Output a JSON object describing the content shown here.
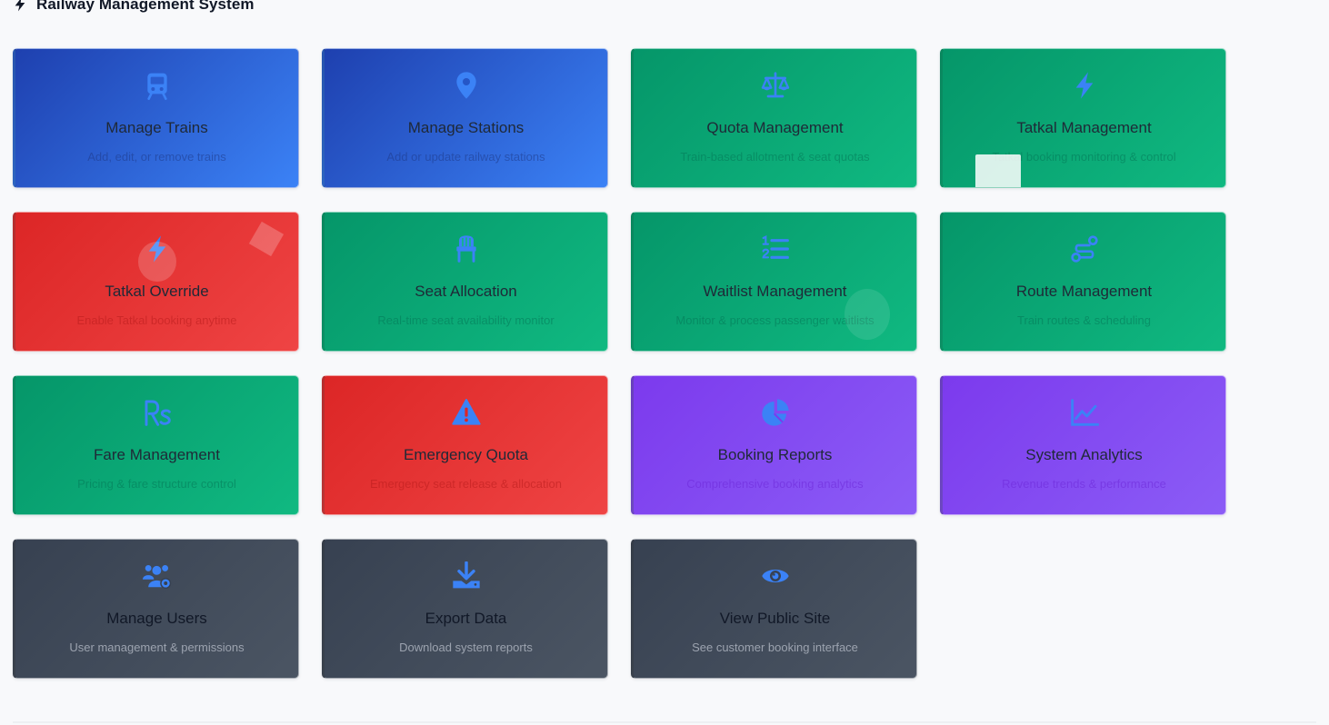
{
  "header": {
    "title": "Railway Management System",
    "icon": "bolt-icon"
  },
  "colors": {
    "icon": "#3b82f6",
    "blue": [
      "#1e40af",
      "#3b82f6"
    ],
    "green": [
      "#059669",
      "#10b981"
    ],
    "red": [
      "#dc2626",
      "#ef4444"
    ],
    "purple": [
      "#7c3aed",
      "#8b5cf6"
    ],
    "slate": [
      "#374151",
      "#4b5563"
    ]
  },
  "cards": [
    {
      "id": "manage-trains",
      "title": "Manage Trains",
      "desc": "Add, edit, or remove trains",
      "icon": "train-icon",
      "theme": "blue"
    },
    {
      "id": "manage-stations",
      "title": "Manage Stations",
      "desc": "Add or update railway stations",
      "icon": "map-pin-icon",
      "theme": "blue"
    },
    {
      "id": "quota-management",
      "title": "Quota Management",
      "desc": "Train-based allotment & seat quotas",
      "icon": "balance-scale-icon",
      "theme": "green"
    },
    {
      "id": "tatkal-management",
      "title": "Tatkal Management",
      "desc": "Tatkal booking monitoring & control",
      "icon": "bolt-icon",
      "theme": "green"
    },
    {
      "id": "tatkal-override",
      "title": "Tatkal Override",
      "desc": "Enable Tatkal booking anytime",
      "icon": "bolt-icon",
      "theme": "red"
    },
    {
      "id": "seat-allocation",
      "title": "Seat Allocation",
      "desc": "Real-time seat availability monitor",
      "icon": "chair-icon",
      "theme": "green"
    },
    {
      "id": "waitlist-management",
      "title": "Waitlist Management",
      "desc": "Monitor & process passenger waitlists",
      "icon": "list-ol-icon",
      "theme": "green"
    },
    {
      "id": "route-management",
      "title": "Route Management",
      "desc": "Train routes & scheduling",
      "icon": "route-icon",
      "theme": "green"
    },
    {
      "id": "fare-management",
      "title": "Fare Management",
      "desc": "Pricing & fare structure control",
      "icon": "rupee-icon",
      "theme": "green"
    },
    {
      "id": "emergency-quota",
      "title": "Emergency Quota",
      "desc": "Emergency seat release & allocation",
      "icon": "warning-icon",
      "theme": "red"
    },
    {
      "id": "booking-reports",
      "title": "Booking Reports",
      "desc": "Comprehensive booking analytics",
      "icon": "pie-chart-icon",
      "theme": "purple"
    },
    {
      "id": "system-analytics",
      "title": "System Analytics",
      "desc": "Revenue trends & performance",
      "icon": "line-chart-icon",
      "theme": "purple"
    },
    {
      "id": "manage-users",
      "title": "Manage Users",
      "desc": "User management & permissions",
      "icon": "users-cog-icon",
      "theme": "slate"
    },
    {
      "id": "export-data",
      "title": "Export Data",
      "desc": "Download system reports",
      "icon": "download-icon",
      "theme": "slate"
    },
    {
      "id": "view-public-site",
      "title": "View Public Site",
      "desc": "See customer booking interface",
      "icon": "eye-icon",
      "theme": "slate"
    }
  ]
}
